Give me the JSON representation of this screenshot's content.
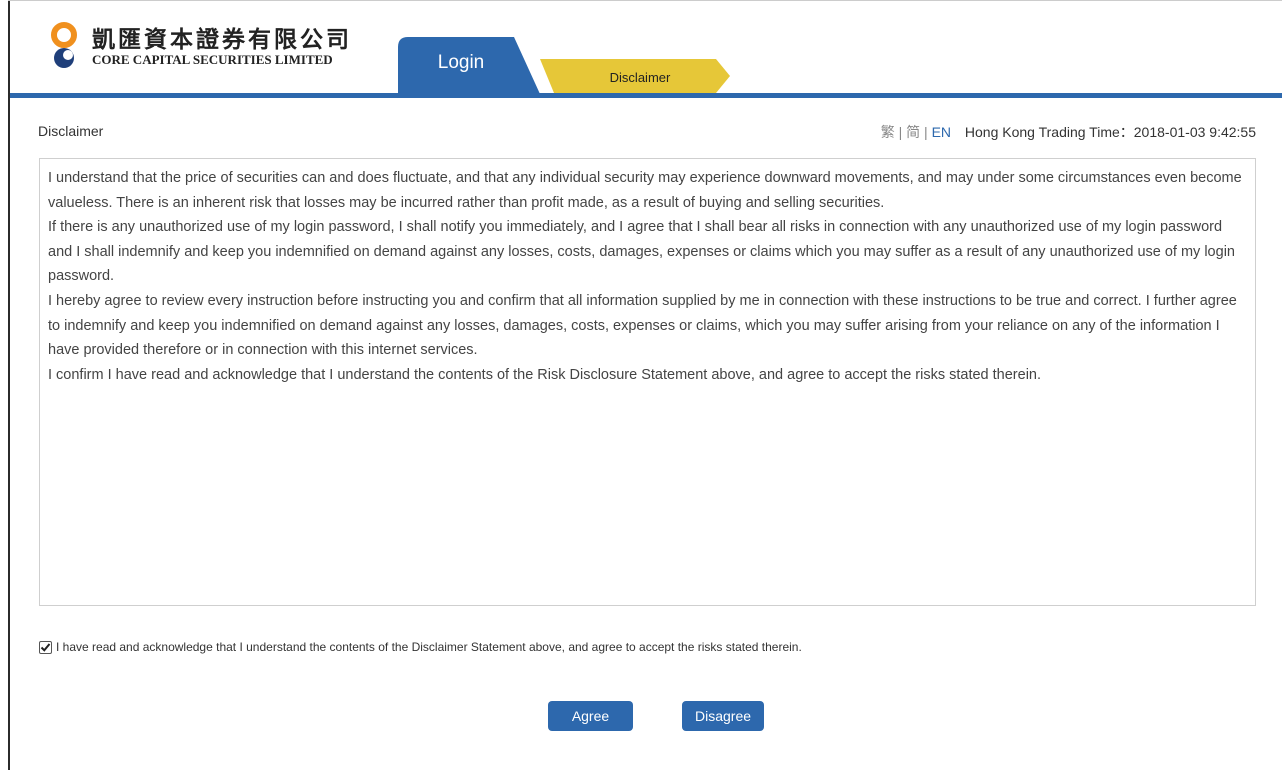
{
  "brand": {
    "name_cn": "凱匯資本證券有限公司",
    "name_en": "CORE CAPITAL SECURITIES LIMITED",
    "colors": {
      "primary": "#2d68ad",
      "tab_yellow": "#e6c738",
      "logo_orange": "#f0901e",
      "logo_navy": "#1f3f7a"
    }
  },
  "tabs": {
    "login": "Login",
    "disclaimer": "Disclaimer"
  },
  "page": {
    "title": "Disclaimer"
  },
  "language": {
    "traditional": "繁",
    "simplified": "简",
    "english": "EN",
    "separator": "|",
    "active": "EN"
  },
  "trading_time": {
    "label": "Hong Kong Trading Time：2018-01-03 9:42:55"
  },
  "disclaimer": {
    "paragraphs": [
      "I understand that the price of securities can and does fluctuate, and that any individual security may experience downward movements, and may under some circumstances even become valueless. There is an inherent risk that losses may be incurred rather than profit made, as a result of buying and selling securities.",
      "If there is any unauthorized use of my login password, I shall notify you immediately, and I agree that I shall bear all risks in connection with any unauthorized use of my login password and I shall indemnify and keep you indemnified on demand against any losses, costs, damages, expenses or claims which you may suffer as a result of any unauthorized use of my login password.",
      "I hereby agree to review every instruction before instructing you and confirm that all information supplied by me in connection with these instructions to be true and correct. I further agree to indemnify and keep you indemnified on demand against any losses, damages, costs, expenses or claims, which you may suffer arising from your reliance on any of the information I have provided therefore or in connection with this internet services.",
      "I confirm I have read and acknowledge that I understand the contents of the Risk Disclosure Statement above, and agree to accept the risks stated therein."
    ]
  },
  "acknowledge": {
    "checked": true,
    "text": "I have read and acknowledge that I understand the contents of the Disclaimer Statement above, and agree to accept the risks stated therein."
  },
  "buttons": {
    "agree": "Agree",
    "disagree": "Disagree"
  }
}
